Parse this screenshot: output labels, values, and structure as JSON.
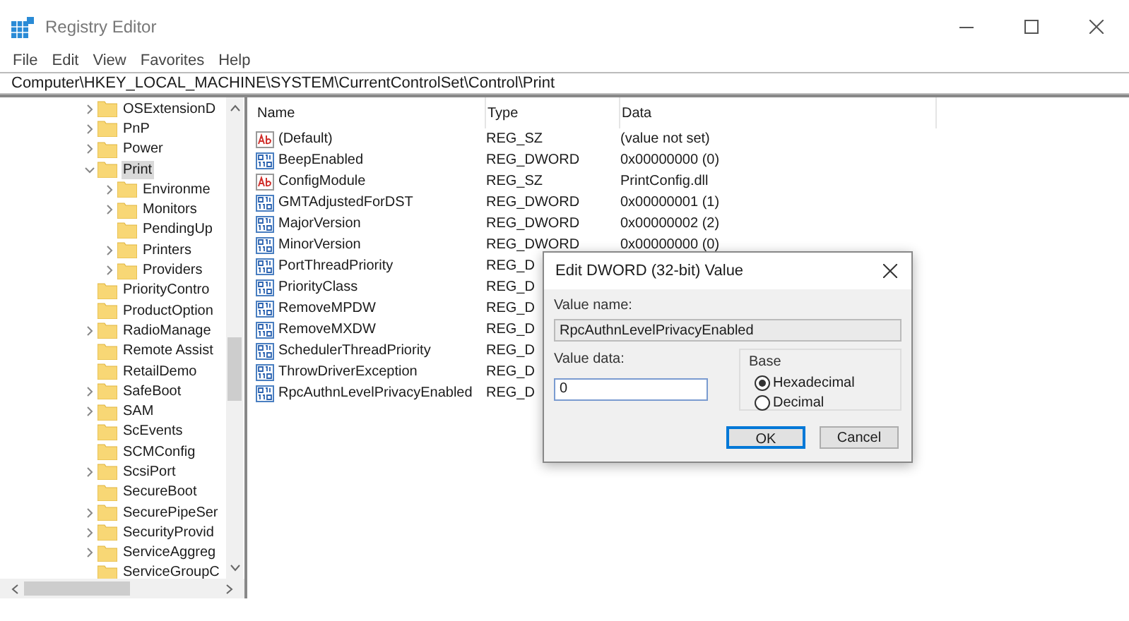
{
  "window": {
    "title": "Registry Editor"
  },
  "menu": [
    "File",
    "Edit",
    "View",
    "Favorites",
    "Help"
  ],
  "address": "Computer\\HKEY_LOCAL_MACHINE\\SYSTEM\\CurrentControlSet\\Control\\Print",
  "tree": [
    {
      "label": "OSExtensionD",
      "expandable": true,
      "expanded": false,
      "selected": false
    },
    {
      "label": "PnP",
      "expandable": true,
      "expanded": false,
      "selected": false
    },
    {
      "label": "Power",
      "expandable": true,
      "expanded": false,
      "selected": false
    },
    {
      "label": "Print",
      "expandable": true,
      "expanded": true,
      "selected": true,
      "children": [
        {
          "label": "Environme",
          "expandable": true,
          "expanded": false,
          "selected": false
        },
        {
          "label": "Monitors",
          "expandable": true,
          "expanded": false,
          "selected": false
        },
        {
          "label": "PendingUp",
          "expandable": false,
          "selected": false
        },
        {
          "label": "Printers",
          "expandable": true,
          "expanded": false,
          "selected": false
        },
        {
          "label": "Providers",
          "expandable": true,
          "expanded": false,
          "selected": false
        }
      ]
    },
    {
      "label": "PriorityContro",
      "expandable": false,
      "selected": false
    },
    {
      "label": "ProductOption",
      "expandable": false,
      "selected": false
    },
    {
      "label": "RadioManage",
      "expandable": true,
      "expanded": false,
      "selected": false
    },
    {
      "label": "Remote Assist",
      "expandable": false,
      "selected": false
    },
    {
      "label": "RetailDemo",
      "expandable": false,
      "selected": false
    },
    {
      "label": "SafeBoot",
      "expandable": true,
      "expanded": false,
      "selected": false
    },
    {
      "label": "SAM",
      "expandable": true,
      "expanded": false,
      "selected": false
    },
    {
      "label": "ScEvents",
      "expandable": false,
      "selected": false
    },
    {
      "label": "SCMConfig",
      "expandable": false,
      "selected": false
    },
    {
      "label": "ScsiPort",
      "expandable": true,
      "expanded": false,
      "selected": false
    },
    {
      "label": "SecureBoot",
      "expandable": false,
      "selected": false
    },
    {
      "label": "SecurePipeSer",
      "expandable": true,
      "expanded": false,
      "selected": false
    },
    {
      "label": "SecurityProvid",
      "expandable": true,
      "expanded": false,
      "selected": false
    },
    {
      "label": "ServiceAggreg",
      "expandable": true,
      "expanded": false,
      "selected": false
    },
    {
      "label": "ServiceGroupC",
      "expandable": false,
      "selected": false
    }
  ],
  "table": {
    "columns": [
      "Name",
      "Type",
      "Data"
    ],
    "rows": [
      {
        "kind": "string",
        "name": "(Default)",
        "type": "REG_SZ",
        "data": "(value not set)"
      },
      {
        "kind": "dword",
        "name": "BeepEnabled",
        "type": "REG_DWORD",
        "data": "0x00000000 (0)"
      },
      {
        "kind": "string",
        "name": "ConfigModule",
        "type": "REG_SZ",
        "data": "PrintConfig.dll"
      },
      {
        "kind": "dword",
        "name": "GMTAdjustedForDST",
        "type": "REG_DWORD",
        "data": "0x00000001 (1)"
      },
      {
        "kind": "dword",
        "name": "MajorVersion",
        "type": "REG_DWORD",
        "data": "0x00000002 (2)"
      },
      {
        "kind": "dword",
        "name": "MinorVersion",
        "type": "REG_DWORD",
        "data": "0x00000000 (0)"
      },
      {
        "kind": "dword",
        "name": "PortThreadPriority",
        "type": "REG_D"
      },
      {
        "kind": "dword",
        "name": "PriorityClass",
        "type": "REG_D"
      },
      {
        "kind": "dword",
        "name": "RemoveMPDW",
        "type": "REG_D"
      },
      {
        "kind": "dword",
        "name": "RemoveMXDW",
        "type": "REG_D"
      },
      {
        "kind": "dword",
        "name": "SchedulerThreadPriority",
        "type": "REG_D"
      },
      {
        "kind": "dword",
        "name": "ThrowDriverException",
        "type": "REG_D"
      },
      {
        "kind": "dword",
        "name": "RpcAuthnLevelPrivacyEnabled",
        "type": "REG_D"
      }
    ]
  },
  "dialog": {
    "title": "Edit DWORD (32-bit) Value",
    "value_name_label": "Value name:",
    "value_name": "RpcAuthnLevelPrivacyEnabled",
    "value_data_label": "Value data:",
    "value_data": "0",
    "base_label": "Base",
    "base_options": [
      {
        "label": "Hexadecimal",
        "selected": true
      },
      {
        "label": "Decimal",
        "selected": false
      }
    ],
    "buttons": [
      {
        "label": "OK",
        "default": true
      },
      {
        "label": "Cancel",
        "default": false
      }
    ]
  }
}
